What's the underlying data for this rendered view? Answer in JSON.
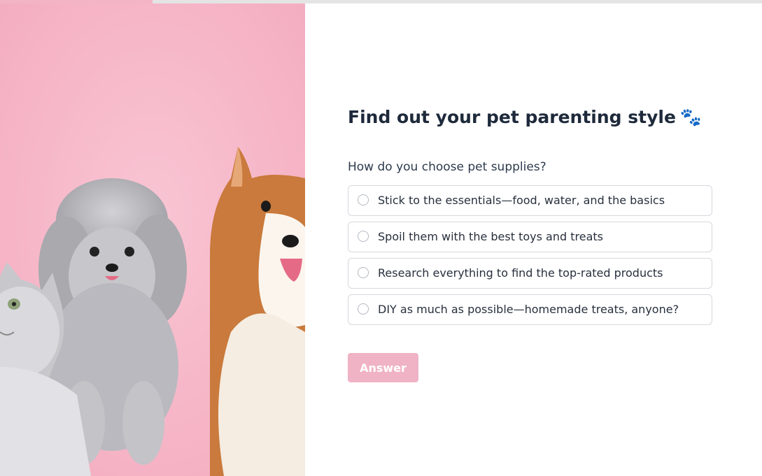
{
  "progress": {
    "fraction": 0.2
  },
  "hero": {
    "image_description": "pet-photo",
    "background_color": "#f6b3c6"
  },
  "quiz": {
    "title": "Find out your pet parenting style",
    "title_emoji": "🐾",
    "question": "How do you choose pet supplies?",
    "options": [
      {
        "label": "Stick to the essentials—food, water, and the basics",
        "selected": false
      },
      {
        "label": "Spoil them with the best toys and treats",
        "selected": false
      },
      {
        "label": "Research everything to find the top-rated products",
        "selected": false
      },
      {
        "label": "DIY as much as possible—homemade treats, anyone?",
        "selected": false
      }
    ],
    "answer_button": "Answer"
  },
  "colors": {
    "accent": "#f0b3c5",
    "title": "#1e2a3b",
    "border": "#d5d8dd",
    "progress_track": "#e4e4e4"
  }
}
